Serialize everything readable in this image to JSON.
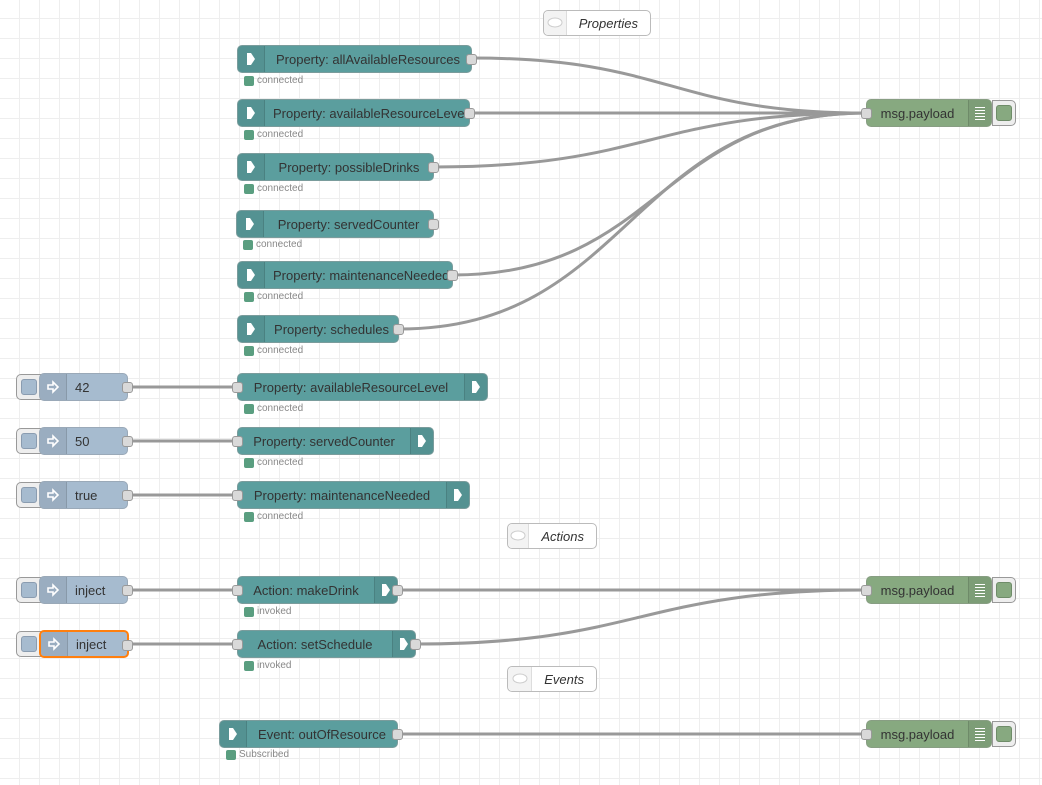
{
  "comments": {
    "properties": "Properties",
    "actions": "Actions",
    "events": "Events"
  },
  "status": {
    "connected": "connected",
    "invoked": "invoked",
    "subscribed": "Subscribed"
  },
  "property_reads": [
    {
      "label": "Property: allAvailableResources"
    },
    {
      "label": "Property: availableResourceLevel"
    },
    {
      "label": "Property: possibleDrinks"
    },
    {
      "label": "Property: servedCounter"
    },
    {
      "label": "Property: maintenanceNeeded"
    },
    {
      "label": "Property: schedules"
    }
  ],
  "property_writes": [
    {
      "inject": "42",
      "label": "Property: availableResourceLevel"
    },
    {
      "inject": "50",
      "label": "Property: servedCounter"
    },
    {
      "inject": "true",
      "label": "Property: maintenanceNeeded"
    }
  ],
  "actions": [
    {
      "inject": "inject",
      "label": "Action: makeDrink"
    },
    {
      "inject": "inject",
      "label": "Action: setSchedule"
    }
  ],
  "events": [
    {
      "label": "Event: outOfResource"
    }
  ],
  "debug": {
    "label": "msg.payload"
  },
  "colors": {
    "thing_node": "#5b9e9e",
    "debug_node": "#87a980",
    "inject_node": "#a6bbcf",
    "status_dot": "#5a9e80",
    "selected": "#ff7f0e",
    "wire": "#999999"
  }
}
